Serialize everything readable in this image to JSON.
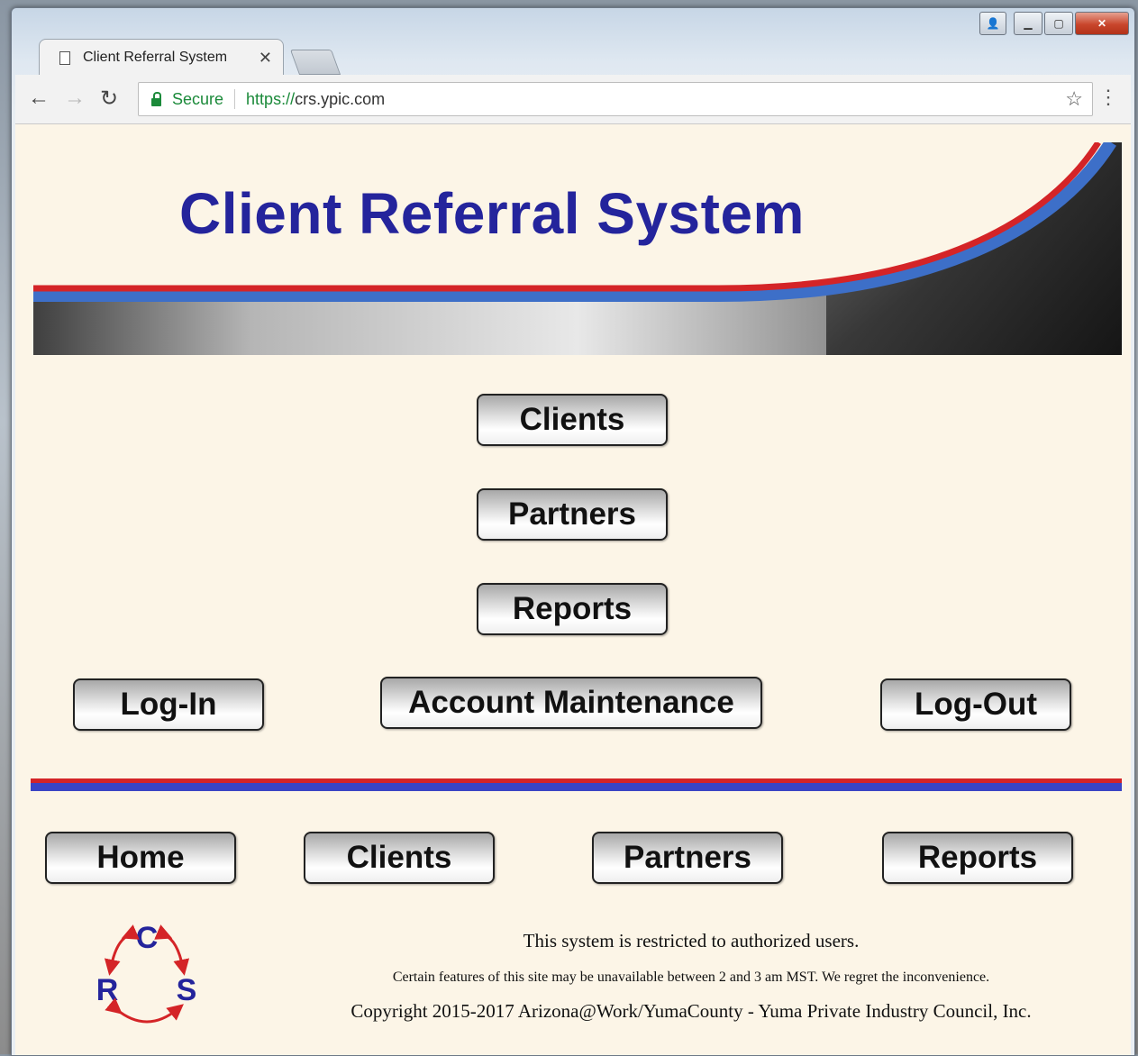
{
  "browser": {
    "tab_title": "Client Referral System",
    "secure_label": "Secure",
    "url_scheme": "https://",
    "url_host": "crs.ypic.com"
  },
  "banner": {
    "title": "Client Referral System"
  },
  "main_nav": {
    "clients": "Clients",
    "partners": "Partners",
    "reports": "Reports",
    "login": "Log-In",
    "account_maintenance": "Account Maintenance",
    "logout": "Log-Out"
  },
  "footer_nav": {
    "home": "Home",
    "clients": "Clients",
    "partners": "Partners",
    "reports": "Reports"
  },
  "logo": {
    "letters": [
      "C",
      "R",
      "S"
    ]
  },
  "footer": {
    "restricted": "This system is restricted to authorized users.",
    "notice": "Certain features of this site may be unavailable between 2 and 3 am MST. We regret the inconvenience.",
    "copyright": "Copyright 2015-2017 Arizona@Work/YumaCounty - Yuma Private Industry Council, Inc."
  },
  "colors": {
    "title_blue": "#24249c",
    "stripe_red": "#d42427",
    "stripe_blue": "#3a44c4",
    "page_bg": "#fcf5e7"
  }
}
